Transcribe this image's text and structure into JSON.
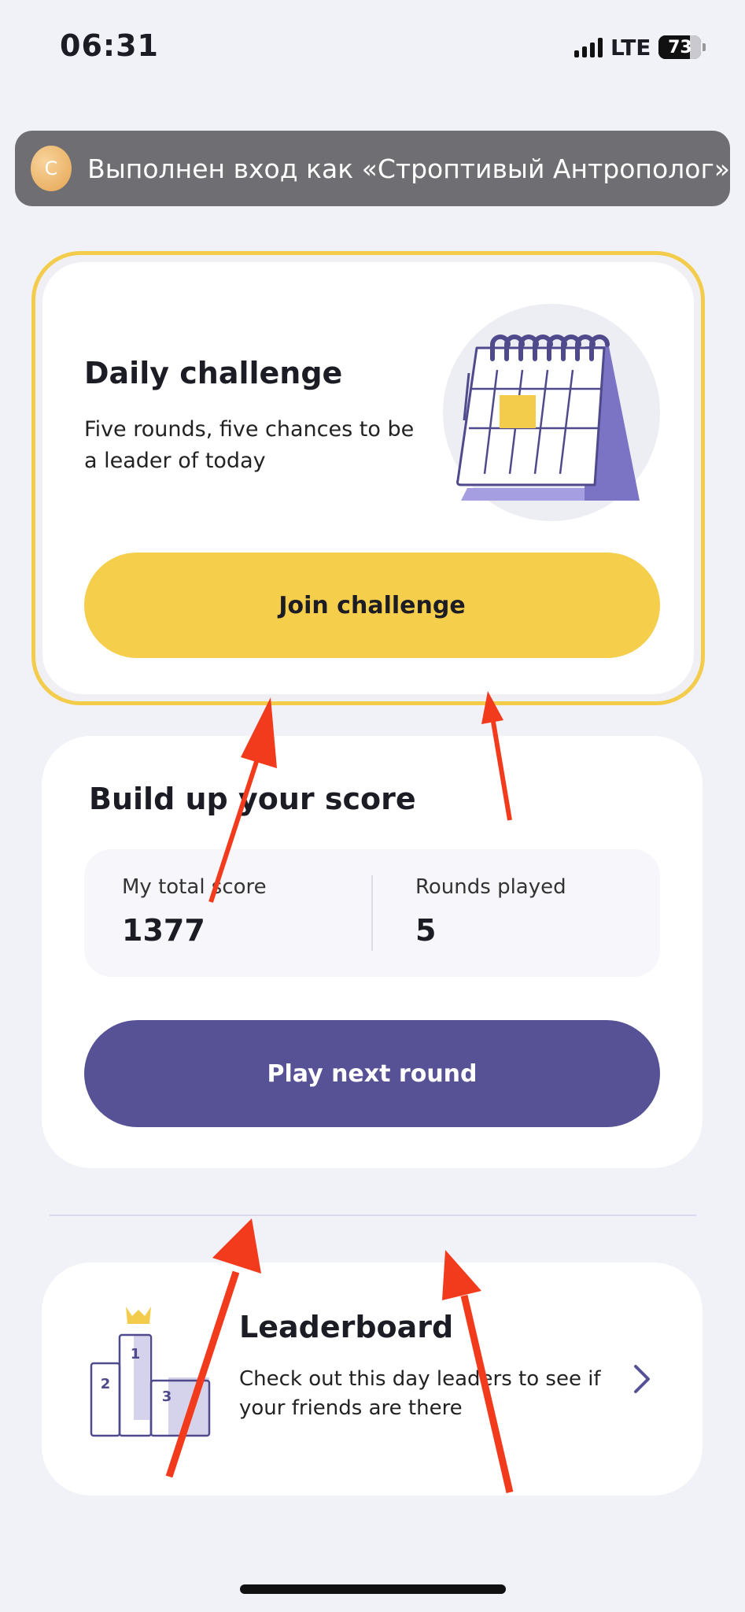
{
  "status_bar": {
    "time": "06:31",
    "network": "LTE",
    "battery": "73",
    "battery_level": 0.73
  },
  "login_banner": {
    "avatar_letter": "С",
    "text": "Выполнен вход как «Строптивый Антрополог»"
  },
  "daily_challenge": {
    "title": "Daily challenge",
    "description": "Five rounds, five chances to be a leader of today",
    "button_label": "Join challenge",
    "icon": "calendar-icon"
  },
  "score": {
    "title": "Build up your score",
    "total_label": "My total score",
    "total_value": "1377",
    "rounds_label": "Rounds played",
    "rounds_value": "5",
    "button_label": "Play next round"
  },
  "leaderboard": {
    "title": "Leaderboard",
    "description": "Check out this day leaders to see if your friends are there",
    "podium_places": [
      "1",
      "2",
      "3"
    ],
    "icon": "podium-icon",
    "chevron": "chevron-right-icon"
  },
  "colors": {
    "background": "#F1F1F8",
    "accent_yellow": "#F5CE4B",
    "accent_purple": "#575296",
    "annotation_red": "#F23A1C"
  }
}
